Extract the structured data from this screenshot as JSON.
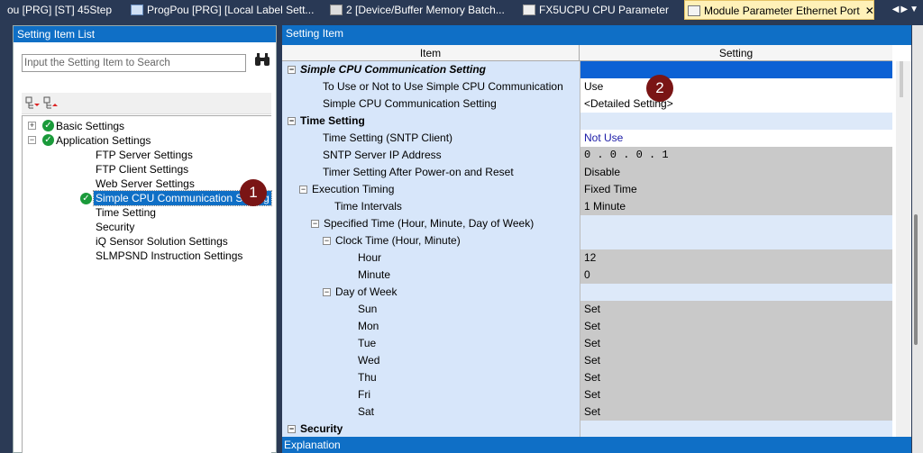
{
  "tabs": [
    {
      "label": "ou [PRG] [ST] 45Step",
      "active": false
    },
    {
      "label": "ProgPou [PRG] [Local Label Sett...",
      "active": false
    },
    {
      "label": "2 [Device/Buffer Memory Batch...",
      "active": false
    },
    {
      "label": "FX5UCPU CPU Parameter",
      "active": false
    },
    {
      "label": "Module Parameter Ethernet Port",
      "active": true
    }
  ],
  "left_panel": {
    "title": "Setting Item List",
    "search_placeholder": "Input the Setting Item to Search",
    "tree": [
      {
        "label": "Basic Settings",
        "level": 0,
        "expander": "+",
        "check": true
      },
      {
        "label": "Application Settings",
        "level": 0,
        "expander": "-",
        "check": true
      },
      {
        "label": "FTP Server Settings",
        "level": 1
      },
      {
        "label": "FTP Client Settings",
        "level": 1
      },
      {
        "label": "Web Server Settings",
        "level": 1
      },
      {
        "label": "Simple CPU Communication Setting",
        "level": 1,
        "check": true,
        "selected": true
      },
      {
        "label": "Time Setting",
        "level": 1
      },
      {
        "label": "Security",
        "level": 1
      },
      {
        "label": "iQ Sensor Solution Settings",
        "level": 1
      },
      {
        "label": "SLMPSND Instruction Settings",
        "level": 1
      }
    ],
    "marker": "1"
  },
  "right_panel": {
    "title": "Setting Item",
    "col_item": "Item",
    "col_setting": "Setting",
    "marker": "2",
    "rows": [
      {
        "item": "Simple CPU Communication Setting",
        "setting": "",
        "indent": 0,
        "expander": "-",
        "group": true,
        "style": "blue",
        "italic": true
      },
      {
        "item": "To Use or Not to Use Simple CPU Communication",
        "setting": "Use",
        "indent": 1,
        "style": "white"
      },
      {
        "item": "Simple CPU Communication Setting",
        "setting": "<Detailed Setting>",
        "indent": 1,
        "style": "white"
      },
      {
        "item": "Time Setting",
        "setting": "",
        "indent": 0,
        "expander": "-",
        "group": true,
        "style": "ltblue"
      },
      {
        "item": "Time Setting (SNTP Client)",
        "setting": "Not Use",
        "indent": 1,
        "style": "white blue-text"
      },
      {
        "item": "SNTP Server IP Address",
        "setting": "  0 .  0 .  0 .  1",
        "indent": 1,
        "style": "gray"
      },
      {
        "item": "Timer Setting After Power-on and Reset",
        "setting": "Disable",
        "indent": 1,
        "style": "gray"
      },
      {
        "item": "Execution Timing",
        "setting": "Fixed Time",
        "indent": 1,
        "expander": "-",
        "style": "gray"
      },
      {
        "item": "Time Intervals",
        "setting": "1 Minute",
        "indent": 2,
        "style": "gray"
      },
      {
        "item": "Specified Time (Hour, Minute, Day of Week)",
        "setting": "",
        "indent": 2,
        "expander": "-",
        "style": "ltblue"
      },
      {
        "item": "Clock Time (Hour, Minute)",
        "setting": "",
        "indent": 3,
        "expander": "-",
        "style": "ltblue"
      },
      {
        "item": "Hour",
        "setting": "12",
        "indent": 4,
        "style": "gray"
      },
      {
        "item": "Minute",
        "setting": "0",
        "indent": 4,
        "style": "gray"
      },
      {
        "item": "Day of Week",
        "setting": "",
        "indent": 3,
        "expander": "-",
        "style": "ltblue"
      },
      {
        "item": "Sun",
        "setting": "Set",
        "indent": 4,
        "style": "gray"
      },
      {
        "item": "Mon",
        "setting": "Set",
        "indent": 4,
        "style": "gray"
      },
      {
        "item": "Tue",
        "setting": "Set",
        "indent": 4,
        "style": "gray"
      },
      {
        "item": "Wed",
        "setting": "Set",
        "indent": 4,
        "style": "gray"
      },
      {
        "item": "Thu",
        "setting": "Set",
        "indent": 4,
        "style": "gray"
      },
      {
        "item": "Fri",
        "setting": "Set",
        "indent": 4,
        "style": "gray"
      },
      {
        "item": "Sat",
        "setting": "Set",
        "indent": 4,
        "style": "gray"
      },
      {
        "item": "Security",
        "setting": "",
        "indent": 0,
        "expander": "-",
        "group": true,
        "style": "ltblue"
      }
    ]
  },
  "explanation": {
    "title": "Explanation"
  },
  "colors": {
    "header_blue": "#0f6fc6",
    "marker_red": "#7a1515",
    "grid_item_bg": "#d7e6fa",
    "grid_gray": "#c9c9c9"
  }
}
